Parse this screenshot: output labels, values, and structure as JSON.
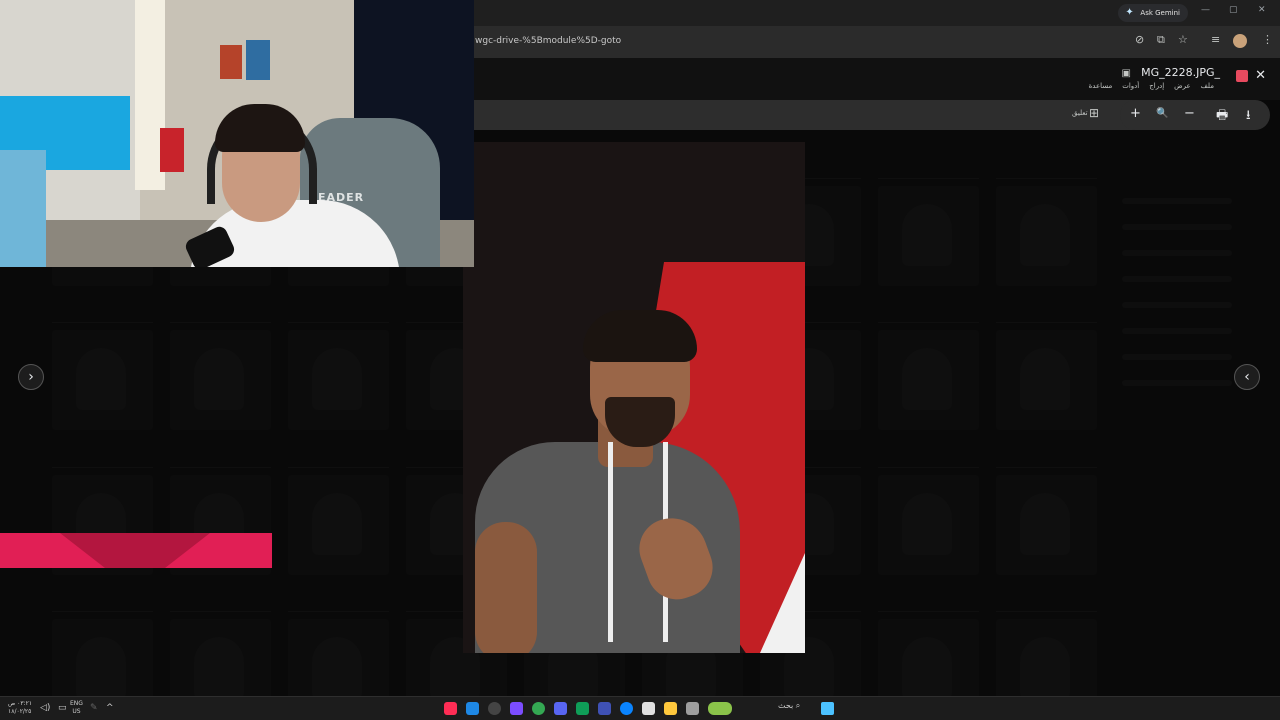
{
  "browser": {
    "gemini_label": "Ask Gemini",
    "url": "wgc-drive-%5Bmodule%5D-goto",
    "window_controls": [
      "—",
      "▢",
      "✕"
    ]
  },
  "viewer": {
    "file_name": "MG_2228.JPG_",
    "menu": [
      "مساعدة",
      "أدوات",
      "إدراج",
      "عرض",
      "ملف"
    ],
    "open_with": "تعليق",
    "tools": [
      "+",
      "🔍",
      "−",
      "🖶",
      "⭳"
    ],
    "close": "✕"
  },
  "webcam": {
    "chair_brand": "LEADER"
  },
  "taskbar": {
    "clock_line1": "٠٣:٢١ ص",
    "clock_line2": "١٨/٠٢/٢٥",
    "lang_line1": "ENG",
    "lang_line2": "US",
    "search_label": "بحث"
  },
  "colors": {
    "accent_red": "#c21f24",
    "banner_pink": "#e11f55",
    "viewer_bg": "#111111"
  }
}
